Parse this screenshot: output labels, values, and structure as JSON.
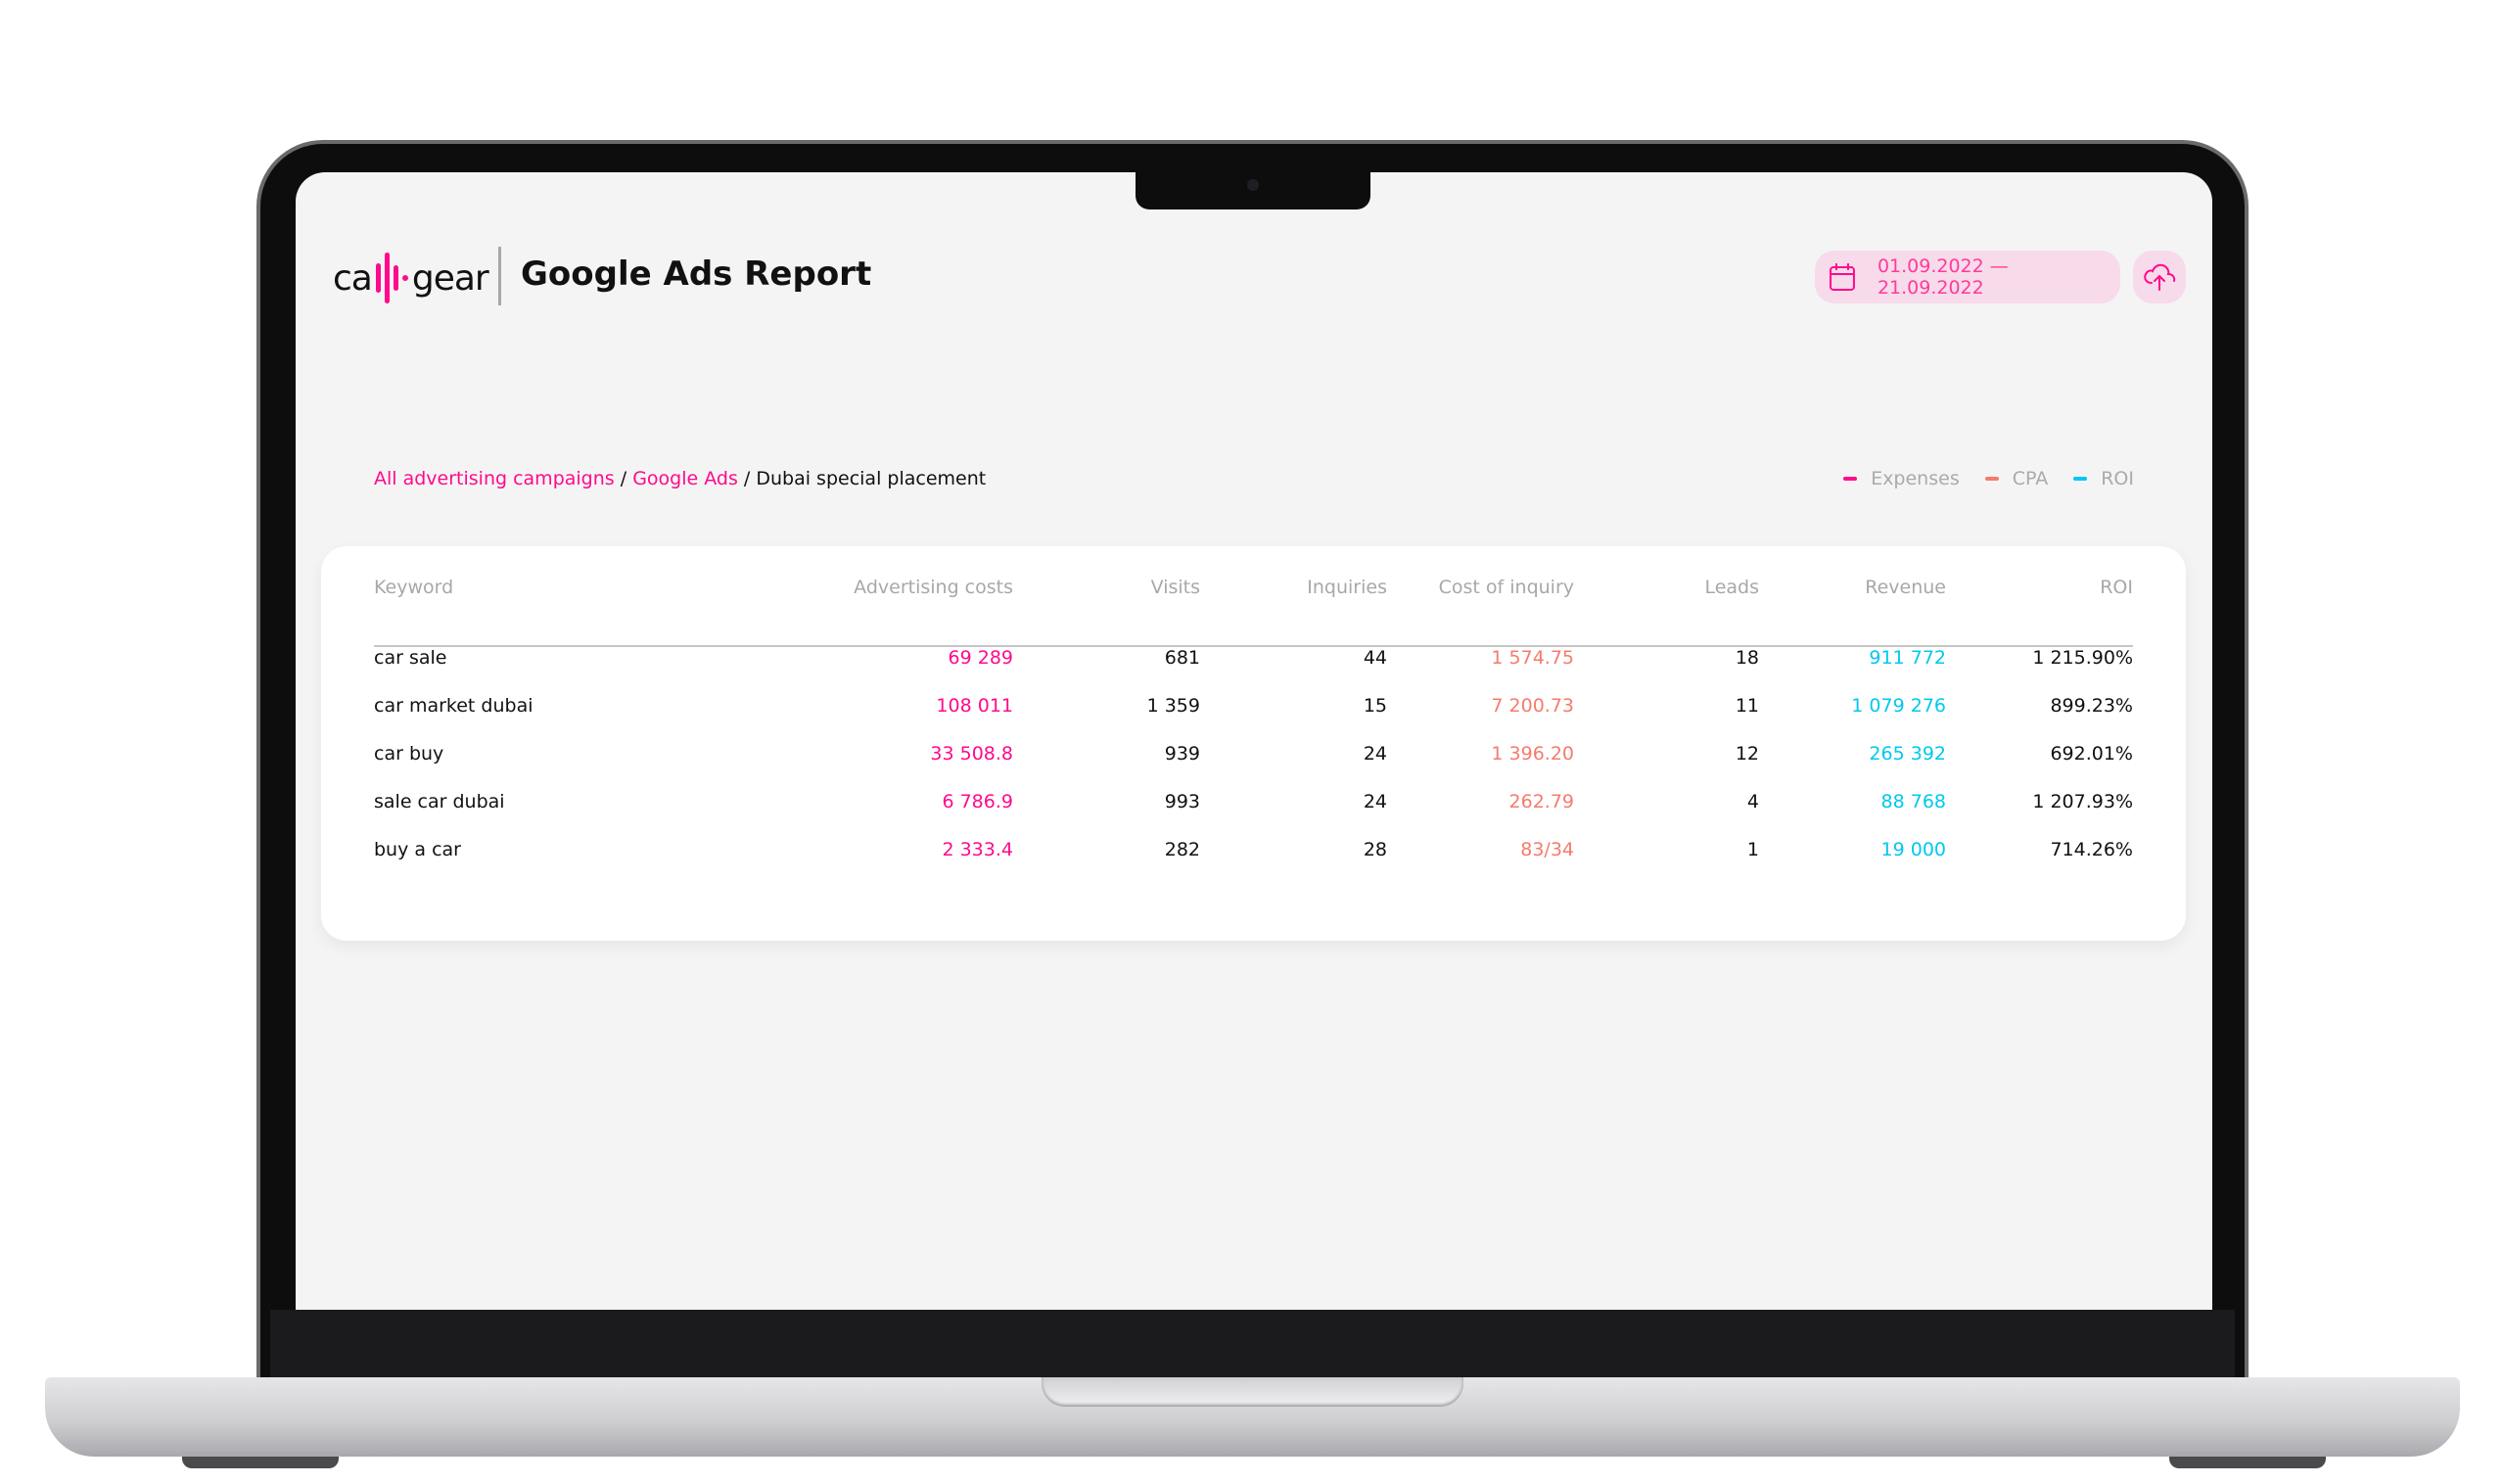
{
  "header": {
    "logo_text": "call-gear",
    "title": "Google Ads Report",
    "date_range": "01.09.2022 — 21.09.2022",
    "date_icon": "calendar-icon",
    "upload_icon": "cloud-upload-icon"
  },
  "breadcrumb": {
    "items": [
      "All advertising campaigns",
      "Google Ads"
    ],
    "current": "Dubai special placement",
    "separator": "/"
  },
  "legend": [
    {
      "label": "Expenses",
      "color": "#ff0a8c"
    },
    {
      "label": "CPA",
      "color": "#f47c6c"
    },
    {
      "label": "ROI",
      "color": "#00c8f0"
    }
  ],
  "colors": {
    "accent": "#ff0a8c",
    "cpa": "#f47c6c",
    "revenue": "#00c8f0",
    "pill_bg": "#f7dbea"
  },
  "table": {
    "columns": [
      "Keyword",
      "Advertising costs",
      "Visits",
      "Inquiries",
      "Cost of inquiry",
      "Leads",
      "Revenue",
      "ROI"
    ],
    "rows": [
      [
        "car sale",
        "69 289",
        "681",
        "44",
        "1 574.75",
        "18",
        "911 772",
        "1 215.90%"
      ],
      [
        "car market dubai",
        "108 011",
        "1 359",
        "15",
        "7 200.73",
        "11",
        "1 079 276",
        "899.23%"
      ],
      [
        "car buy",
        "33 508.8",
        "939",
        "24",
        "1 396.20",
        "12",
        "265 392",
        "692.01%"
      ],
      [
        "sale car dubai",
        "6 786.9",
        "993",
        "24",
        "262.79",
        "4",
        "88 768",
        "1 207.93%"
      ],
      [
        "buy a car",
        "2 333.4",
        "282",
        "28",
        "83/34",
        "1",
        "19 000",
        "714.26%"
      ]
    ]
  }
}
